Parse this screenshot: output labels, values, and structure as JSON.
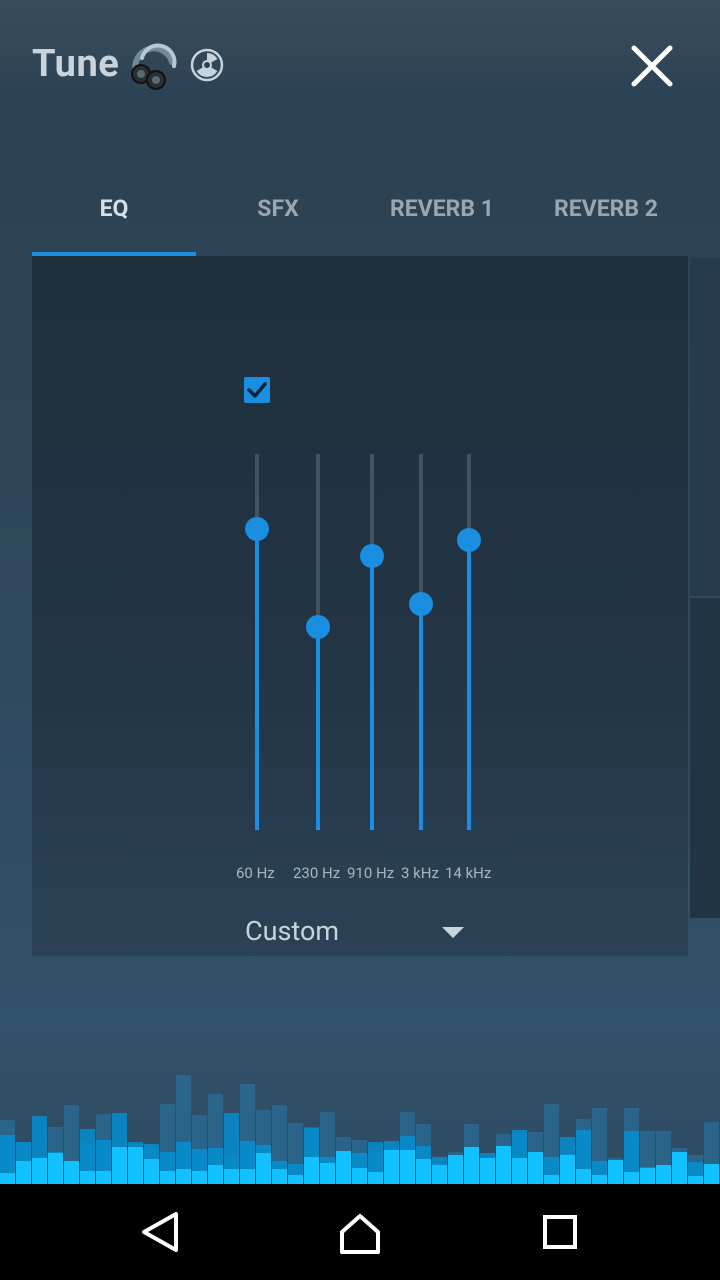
{
  "app": {
    "title": "Tune",
    "icons": [
      "headphones-icon",
      "radiation-icon",
      "close-icon"
    ]
  },
  "tabs": [
    {
      "label": "EQ",
      "active": true
    },
    {
      "label": "SFX",
      "active": false
    },
    {
      "label": "REVERB 1",
      "active": false
    },
    {
      "label": "REVERB 2",
      "active": false
    }
  ],
  "eq": {
    "enabled": true,
    "bands": [
      {
        "label": "60 Hz",
        "level": 0.8
      },
      {
        "label": "230 Hz",
        "level": 0.54
      },
      {
        "label": "910 Hz",
        "level": 0.73
      },
      {
        "label": "3 kHz",
        "level": 0.6
      },
      {
        "label": "14 kHz",
        "level": 0.77
      }
    ],
    "preset": "Custom"
  },
  "navigation": {
    "icons": [
      "back-icon",
      "home-icon",
      "recents-icon"
    ]
  },
  "colors": {
    "accent": "#1a8ee0",
    "visualizer": "#00b4ff"
  }
}
